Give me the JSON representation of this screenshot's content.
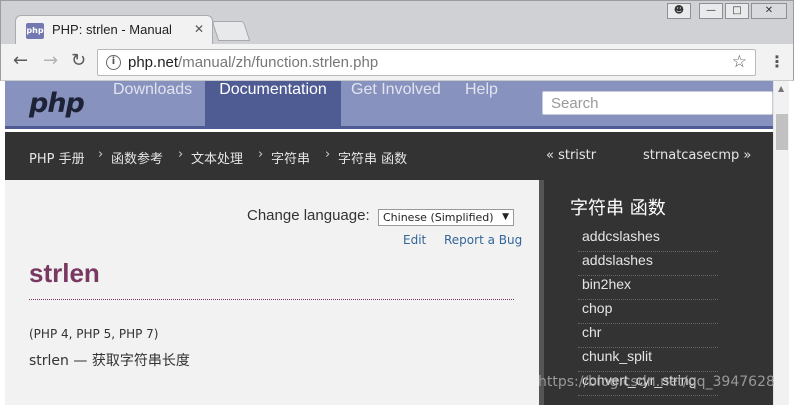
{
  "browser": {
    "tab_favicon": "php",
    "tab_title": "PHP: strlen - Manual",
    "tab_close": "✕",
    "url_domain": "php.net",
    "url_path": "/manual/zh/function.strlen.php",
    "info_icon": "i",
    "icons": [
      "back-arrow-icon",
      "forward-arrow-icon",
      "reload-icon",
      "star-icon",
      "menu-icon"
    ]
  },
  "nav": {
    "logo": "php",
    "links": [
      "Downloads",
      "Documentation",
      "Get Involved",
      "Help"
    ],
    "search_placeholder": "Search",
    "active_color": "#4f5b93",
    "bar_color": "#8892bf"
  },
  "breadcrumb": {
    "items": [
      "PHP 手册",
      "函数参考",
      "文本处理",
      "字符串",
      "字符串 函数"
    ],
    "prev": "« stristr",
    "next": "strnatcasecmp »"
  },
  "content": {
    "change_language_label": "Change language:",
    "language_selected": "Chinese (Simplified)",
    "edit": "Edit",
    "report_bug": "Report a Bug",
    "function_name": "strlen",
    "versions": "(PHP 4, PHP 5, PHP 7)",
    "summary": "strlen — 获取字符串长度"
  },
  "sidebar": {
    "heading": "字符串 函数",
    "items": [
      "addcslashes",
      "addslashes",
      "bin2hex",
      "chop",
      "chr",
      "chunk_split",
      "convert_cyr_string"
    ]
  },
  "watermark": "https://blog.csdn.net/qq_3947628"
}
